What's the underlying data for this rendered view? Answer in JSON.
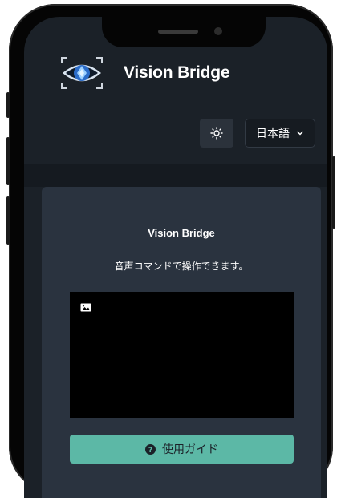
{
  "header": {
    "app_title": "Vision Bridge",
    "theme_icon": "sun-icon",
    "language": {
      "selected": "日本語",
      "icon": "chevron-down-icon"
    }
  },
  "main": {
    "title": "Vision Bridge",
    "subtitle": "音声コマンドで操作できます。",
    "camera_preview_icon": "image-icon",
    "guide_button": {
      "label": "使用ガイド",
      "icon": "question-circle-icon"
    }
  },
  "colors": {
    "background": "#1b2128",
    "card": "#2a333f",
    "accent": "#5cb8a6"
  }
}
